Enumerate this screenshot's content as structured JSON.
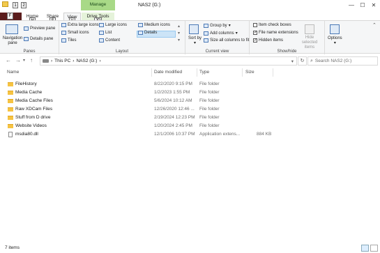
{
  "window": {
    "title": "NAS2 (G:)",
    "context_group": "Manage",
    "minimize": "—",
    "maximize": "☐",
    "close": "✕"
  },
  "keytips": {
    "qat1": "1",
    "qat2": "2",
    "file": "F",
    "home": "H",
    "share": "S",
    "view": "V",
    "drive": "JD"
  },
  "tabs": {
    "home": "Home",
    "share": "Share",
    "view": "View",
    "drive_tools": "Drive Tools"
  },
  "ribbon": {
    "panes": {
      "label": "Panes",
      "navigation_pane": "Navigation pane",
      "preview_pane": "Preview pane",
      "details_pane": "Details pane"
    },
    "layout": {
      "label": "Layout",
      "extra_large": "Extra large icons",
      "large": "Large icons",
      "medium": "Medium icons",
      "small": "Small icons",
      "list": "List",
      "details": "Details",
      "tiles": "Tiles",
      "content": "Content"
    },
    "current_view": {
      "label": "Current view",
      "sort_by": "Sort by",
      "group_by": "Group by",
      "add_columns": "Add columns",
      "size_all": "Size all columns to fit"
    },
    "show_hide": {
      "label": "Show/hide",
      "item_checkboxes": "Item check boxes",
      "file_name_extensions": "File name extensions",
      "hidden_items": "Hidden items",
      "hide_selected": "Hide selected items",
      "item_checkboxes_checked": false,
      "extensions_checked": true,
      "hidden_checked": true
    },
    "options": "Options"
  },
  "address": {
    "path": [
      "This PC",
      "NAS2 (G:)"
    ],
    "search_placeholder": "Search NAS2 (G:)"
  },
  "columns": {
    "name": "Name",
    "date": "Date modified",
    "type": "Type",
    "size": "Size"
  },
  "files": [
    {
      "name": "FileHistory",
      "date": "8/22/2020 9:15 PM",
      "type": "File folder",
      "size": "",
      "kind": "folder"
    },
    {
      "name": "Media Cache",
      "date": "1/2/2023 1:55 PM",
      "type": "File folder",
      "size": "",
      "kind": "folder"
    },
    {
      "name": "Media Cache Files",
      "date": "5/6/2024 10:12 AM",
      "type": "File folder",
      "size": "",
      "kind": "folder"
    },
    {
      "name": "Raw XDCam Files",
      "date": "12/26/2020 12:46 ...",
      "type": "File folder",
      "size": "",
      "kind": "folder"
    },
    {
      "name": "Stuff from D drive",
      "date": "2/19/2024 12:23 PM",
      "type": "File folder",
      "size": "",
      "kind": "folder"
    },
    {
      "name": "Website Videos",
      "date": "1/20/2024 2:45 PM",
      "type": "File folder",
      "size": "",
      "kind": "folder"
    },
    {
      "name": "msdia80.dll",
      "date": "12/1/2006 10:37 PM",
      "type": "Application extens...",
      "size": "884 KB",
      "kind": "file"
    }
  ],
  "status": {
    "item_count": "7 items"
  }
}
